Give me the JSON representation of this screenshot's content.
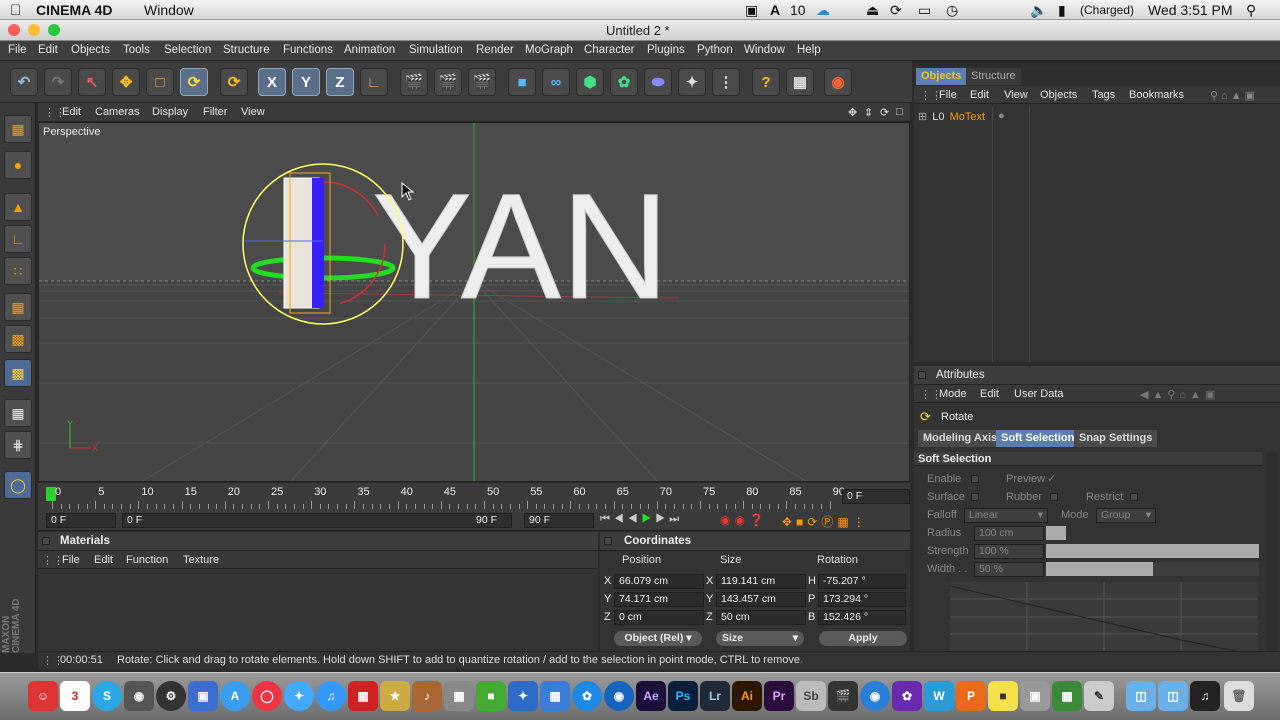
{
  "macbar": {
    "app": "CINEMA 4D",
    "menu": "Window",
    "battery": "(Charged)",
    "clock": "Wed 3:51 PM",
    "adobe_count": "10"
  },
  "window": {
    "title": "Untitled 2 *"
  },
  "menu": [
    "File",
    "Edit",
    "Objects",
    "Tools",
    "Selection",
    "Structure",
    "Functions",
    "Animation",
    "Simulation",
    "Render",
    "MoGraph",
    "Character",
    "Plugins",
    "Python",
    "Window",
    "Help"
  ],
  "viewport": {
    "menu": [
      "Edit",
      "Cameras",
      "Display",
      "Filter",
      "View"
    ],
    "label": "Perspective",
    "text": "YAN",
    "axis_y": "Y",
    "axis_x": "X"
  },
  "timeline": {
    "ticks": [
      "0",
      "5",
      "10",
      "15",
      "20",
      "25",
      "30",
      "35",
      "40",
      "45",
      "50",
      "55",
      "60",
      "65",
      "70",
      "75",
      "80",
      "85",
      "90"
    ],
    "current": "0 F",
    "start": "0 F",
    "range_start": "0 F",
    "range_end": "90 F",
    "end": "90 F"
  },
  "materials": {
    "title": "Materials",
    "menu": [
      "File",
      "Edit",
      "Function",
      "Texture"
    ]
  },
  "coordinates": {
    "title": "Coordinates",
    "headers": [
      "Position",
      "Size",
      "Rotation"
    ],
    "rows": [
      {
        "axis": "X",
        "pos": "66.079 cm",
        "saxis": "X",
        "size": "119.141 cm",
        "raxis": "H",
        "rot": "-75.207 °"
      },
      {
        "axis": "Y",
        "pos": "74.171 cm",
        "saxis": "Y",
        "size": "143.457 cm",
        "raxis": "P",
        "rot": "173.294 °"
      },
      {
        "axis": "Z",
        "pos": "0 cm",
        "saxis": "Z",
        "size": "50 cm",
        "raxis": "B",
        "rot": "152.426 °"
      }
    ],
    "mode": "Object (Rel)",
    "size_mode": "Size",
    "apply": "Apply"
  },
  "objects": {
    "tabs": [
      "Objects",
      "Structure"
    ],
    "menu": [
      "File",
      "Edit",
      "View",
      "Objects",
      "Tags",
      "Bookmarks"
    ],
    "items": [
      "MoText"
    ]
  },
  "attributes": {
    "title": "Attributes",
    "menu": [
      "Mode",
      "Edit",
      "User Data"
    ],
    "tool": "Rotate",
    "tabs": [
      "Modeling Axis",
      "Soft Selection",
      "Snap Settings"
    ],
    "section": "Soft Selection",
    "enable": "Enable",
    "preview": "Preview",
    "surface": "Surface",
    "rubber": "Rubber",
    "restrict": "Restrict",
    "falloff_label": "Falloff",
    "falloff": "Linear",
    "mode_label": "Mode",
    "mode": "Group",
    "radius_label": "Radius",
    "radius": "100 cm",
    "strength_label": "Strength",
    "strength": "100 %",
    "width_label": "Width . .",
    "width": "50 %",
    "strength_value": 1.0,
    "width_value": 0.5
  },
  "status": {
    "time": "00:00:51",
    "message": "Rotate: Click and drag to rotate elements. Hold down SHIFT to add to quantize rotation / add to the selection in point mode, CTRL to remove."
  },
  "branding": "MAXON CINEMA 4D",
  "dock": [
    "Finder",
    "Calendar",
    "Skype",
    "FaceTime",
    "Chrome",
    "Safari",
    "iTunes",
    "Ae",
    "Ps",
    "Lr",
    "Ai",
    "Pr",
    "Sb"
  ]
}
